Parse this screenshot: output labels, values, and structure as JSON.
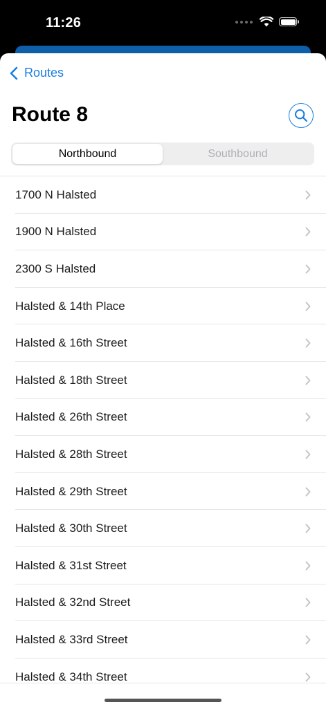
{
  "status_bar": {
    "time": "11:26"
  },
  "nav": {
    "back_label": "Routes"
  },
  "page": {
    "title": "Route 8"
  },
  "segments": [
    {
      "label": "Northbound",
      "selected": true
    },
    {
      "label": "Southbound",
      "selected": false
    }
  ],
  "stops": [
    "1700 N Halsted",
    "1900 N Halsted",
    "2300 S Halsted",
    "Halsted & 14th Place",
    "Halsted & 16th Street",
    "Halsted & 18th Street",
    "Halsted & 26th Street",
    "Halsted & 28th Street",
    "Halsted & 29th Street",
    "Halsted & 30th Street",
    "Halsted & 31st Street",
    "Halsted & 32nd Street",
    "Halsted & 33rd Street",
    "Halsted & 34th Street"
  ],
  "colors": {
    "accent": "#1a7fe0",
    "underlay": "#0f5ea8"
  },
  "icons": [
    "wifi-icon",
    "battery-icon",
    "chevron-left-icon",
    "search-icon",
    "chevron-right-icon"
  ]
}
